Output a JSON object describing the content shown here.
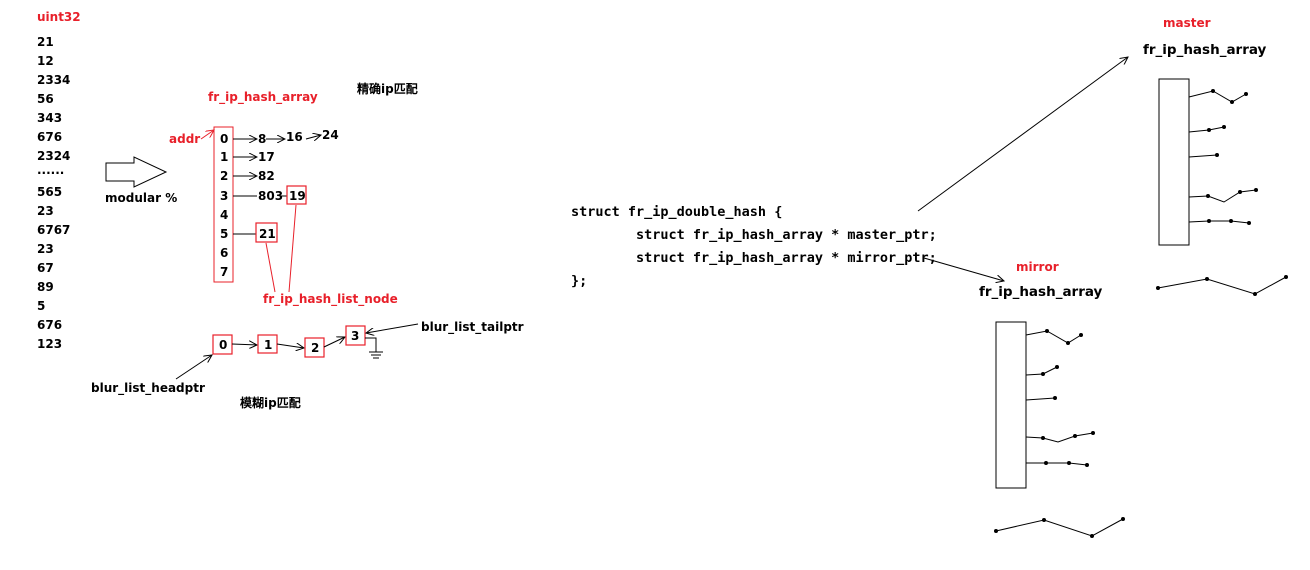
{
  "uint_list": {
    "title": "uint32",
    "values": [
      "21",
      "12",
      "2334",
      "56",
      "343",
      "676",
      "2324",
      "······",
      "565",
      "23",
      "6767",
      "23",
      "67",
      "89",
      "5",
      "676",
      "123"
    ]
  },
  "modular_label": "modular %",
  "hash_array_title": "fr_ip_hash_array",
  "exact_match_label": "精确ip匹配",
  "addr_label": "addr",
  "indices": [
    "0",
    "1",
    "2",
    "3",
    "4",
    "5",
    "6",
    "7"
  ],
  "chains": {
    "row0": [
      "8",
      "16",
      "24"
    ],
    "row1": [
      "17"
    ],
    "row2": [
      "82"
    ],
    "row3": [
      "803",
      "19"
    ],
    "row5": [
      "21"
    ]
  },
  "list_node_label": "fr_ip_hash_list_node",
  "blur_list": {
    "nodes": [
      "0",
      "1",
      "2",
      "3"
    ],
    "tailptr_label": "blur_list_tailptr",
    "headptr_label": "blur_list_headptr",
    "fuzzy_match_label": "模糊ip匹配"
  },
  "code_lines": [
    "struct fr_ip_double_hash {",
    "        struct fr_ip_hash_array * master_ptr;",
    "        struct fr_ip_hash_array * mirror_ptr;",
    "};"
  ],
  "master": {
    "label": "master",
    "array_label": "fr_ip_hash_array"
  },
  "mirror": {
    "label": "mirror",
    "array_label": "fr_ip_hash_array"
  },
  "colors": {
    "accent_red": "#e8202a",
    "ink": "#000000",
    "background": "#ffffff"
  }
}
